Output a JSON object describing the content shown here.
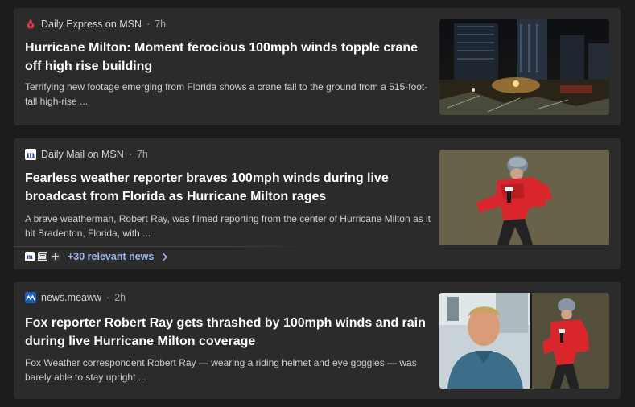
{
  "articles": [
    {
      "source": "Daily Express on MSN",
      "time": "7h",
      "title": "Hurricane Milton: Moment ferocious 100mph winds topple crane off high rise building",
      "snippet": "Terrifying new footage emerging from Florida shows a crane fall to the ground from a 515-foot-tall high-rise ...",
      "logo_icon": "daily-express-logo",
      "thumbnail": "night-city-crane-collapse-photo"
    },
    {
      "source": "Daily Mail on MSN",
      "time": "7h",
      "title": "Fearless weather reporter braves 100mph winds during live broadcast from Florida as Hurricane Milton rages",
      "snippet": "A brave weatherman, Robert Ray, was filmed reporting from the center of Hurricane Milton as it hit Bradenton, Florida, with ...",
      "logo_icon": "daily-mail-logo",
      "thumbnail": "reporter-in-red-jacket-photo",
      "relevant_news": "+30 relevant news"
    },
    {
      "source": "news.meaww",
      "time": "2h",
      "title": "Fox reporter Robert Ray gets thrashed by 100mph winds and rain during live Hurricane Milton coverage",
      "snippet": "Fox Weather correspondent Robert Ray — wearing a riding helmet and eye goggles — was barely able to stay upright ...",
      "logo_icon": "meaww-logo",
      "thumbnail": "reporter-portrait-and-storm-photo"
    }
  ],
  "separator": "·",
  "logo_letters": {
    "mail": "m"
  },
  "colors": {
    "page_bg": "#1c1c1c",
    "card_bg": "#2c2b2b",
    "link": "#9db8f0",
    "jacket_red": "#d8262c"
  }
}
